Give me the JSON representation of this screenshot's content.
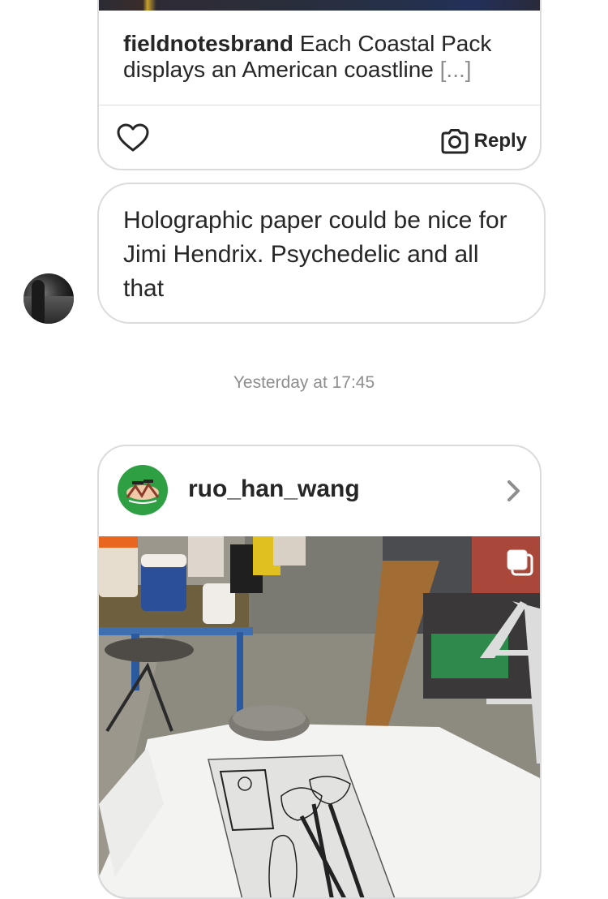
{
  "post_card": {
    "caption_user": "fieldnotesbrand",
    "caption_text": "Each Coastal Pack displays an American coastline",
    "caption_more": "[...]",
    "reply_label": "Reply"
  },
  "message": {
    "text": "Holographic paper could be nice for Jimi Hendrix. Psychedelic and all that"
  },
  "timestamp": "Yesterday at 17:45",
  "shared_post": {
    "username": "ruo_han_wang"
  },
  "icons": [
    "heart-icon",
    "camera-icon",
    "chevron-right-icon",
    "multiple-photos-icon"
  ],
  "colors": {
    "text": "#262626",
    "muted": "#8e8e8e",
    "border": "#dbdbdb",
    "avatar_green": "#2ea043"
  }
}
